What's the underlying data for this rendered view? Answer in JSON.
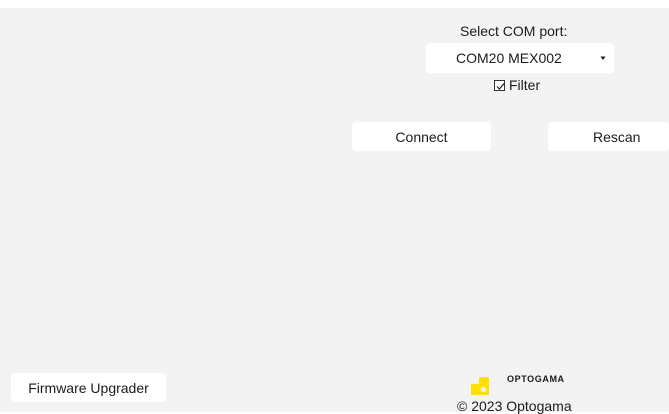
{
  "com_port": {
    "label": "Select COM port:",
    "selected": "COM20 MEX002",
    "filter_label": "Filter",
    "filter_checked": true
  },
  "actions": {
    "connect_label": "Connect",
    "rescan_label": "Rescan",
    "firmware_label": "Firmware Upgrader"
  },
  "branding": {
    "logo_text": "OPTOGAMA",
    "copyright": "© 2023 Optogama",
    "logo_color": "#ffe100"
  },
  "icons": {
    "dropdown": "dropdown-arrow-icon",
    "checkbox": "checkbox-checked-icon",
    "logo": "optogama-logo-icon"
  }
}
